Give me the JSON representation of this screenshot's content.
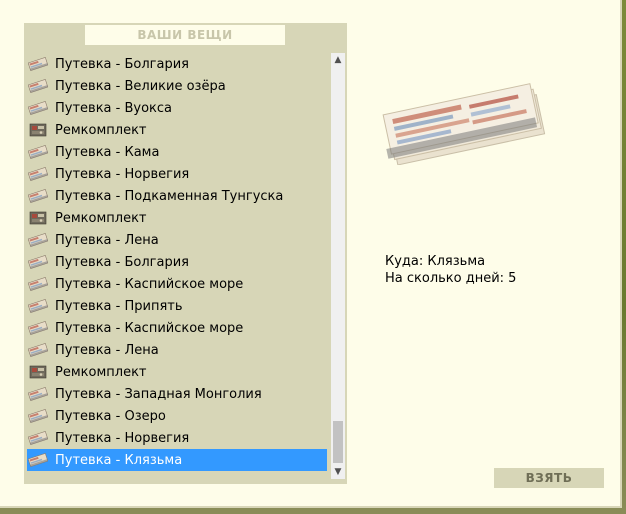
{
  "panel_title": "ВАШИ ВЕЩИ",
  "items": [
    {
      "label": "Путевка - Болгария",
      "icon": "ticket-icon"
    },
    {
      "label": "Путевка - Великие озёра",
      "icon": "ticket-icon"
    },
    {
      "label": "Путевка - Вуокса",
      "icon": "ticket-icon"
    },
    {
      "label": "Ремкомплект",
      "icon": "repair-kit-icon"
    },
    {
      "label": "Путевка - Кама",
      "icon": "ticket-icon"
    },
    {
      "label": "Путевка - Норвегия",
      "icon": "ticket-icon"
    },
    {
      "label": "Путевка - Подкаменная Тунгуска",
      "icon": "ticket-icon"
    },
    {
      "label": "Ремкомплект",
      "icon": "repair-kit-icon"
    },
    {
      "label": "Путевка - Лена",
      "icon": "ticket-icon"
    },
    {
      "label": "Путевка - Болгария",
      "icon": "ticket-icon"
    },
    {
      "label": "Путевка - Каспийское море",
      "icon": "ticket-icon"
    },
    {
      "label": "Путевка - Припять",
      "icon": "ticket-icon"
    },
    {
      "label": "Путевка - Каспийское море",
      "icon": "ticket-icon"
    },
    {
      "label": "Путевка - Лена",
      "icon": "ticket-icon"
    },
    {
      "label": "Ремкомплект",
      "icon": "repair-kit-icon"
    },
    {
      "label": "Путевка - Западная Монголия",
      "icon": "ticket-icon"
    },
    {
      "label": "Путевка - Озеро",
      "icon": "ticket-icon"
    },
    {
      "label": "Путевка - Норвегия",
      "icon": "ticket-icon"
    },
    {
      "label": "Путевка - Клязьма",
      "icon": "ticket-icon",
      "selected": true
    }
  ],
  "details": {
    "destination": "Куда: Клязьма",
    "days": "На сколько дней: 5"
  },
  "take_button": "ВЗЯТЬ",
  "colors": {
    "selection": "#3399ff",
    "panel": "#d7d6b7",
    "background": "#fefde9"
  }
}
